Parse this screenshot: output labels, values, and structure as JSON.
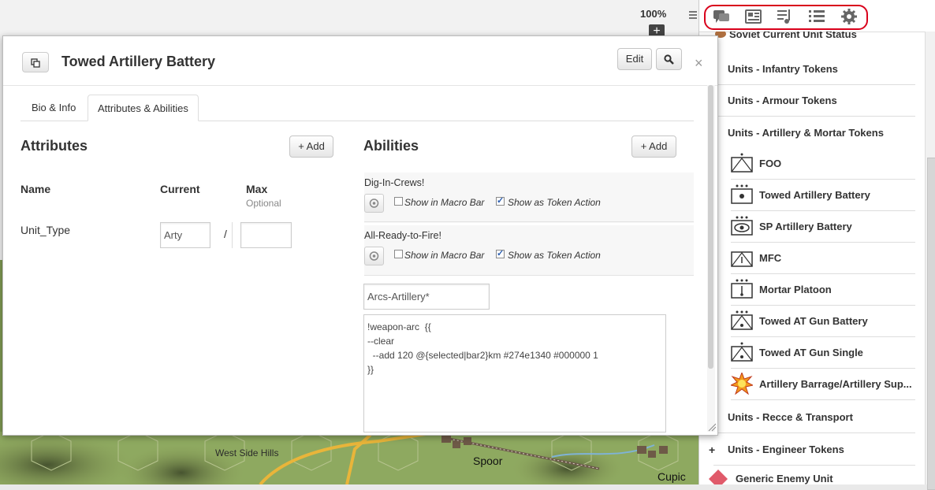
{
  "canvas": {
    "zoom": "100%",
    "zoom_in_label": "+",
    "map_labels": [
      "West Side Hills",
      "Spoor",
      "Cupic"
    ]
  },
  "sidebar": {
    "tabs": [
      {
        "name": "chat",
        "icon": "chat-bubbles-icon"
      },
      {
        "name": "journal",
        "icon": "journal-icon"
      },
      {
        "name": "jukebox",
        "icon": "music-list-icon"
      },
      {
        "name": "compendium",
        "icon": "list-icon"
      },
      {
        "name": "settings",
        "icon": "gear-icon"
      }
    ],
    "highlight_color": "#d9001b",
    "partial_top_label": "Soviet Current Unit Status",
    "folders": [
      {
        "label": "Units - Infantry Tokens",
        "expander": "+"
      },
      {
        "label": "Units - Armour Tokens",
        "expander": "+"
      },
      {
        "label": "Units - Artillery & Mortar Tokens",
        "expander": "-"
      },
      {
        "label": "Units - Recce & Transport",
        "expander": "+"
      },
      {
        "label": "Units - Engineer Tokens",
        "expander": "+"
      }
    ],
    "items": [
      {
        "label": "FOO",
        "icon": "foo-unit-icon"
      },
      {
        "label": "Towed Artillery Battery",
        "icon": "towed-artillery-icon"
      },
      {
        "label": "SP Artillery Battery",
        "icon": "sp-artillery-icon"
      },
      {
        "label": "MFC",
        "icon": "mfc-unit-icon"
      },
      {
        "label": "Mortar Platoon",
        "icon": "mortar-platoon-icon"
      },
      {
        "label": "Towed AT Gun Battery",
        "icon": "towed-at-gun-battery-icon"
      },
      {
        "label": "Towed AT Gun Single",
        "icon": "towed-at-gun-single-icon"
      },
      {
        "label": "Artillery Barrage/Artillery Sup...",
        "icon": "explosion-icon"
      }
    ],
    "bottom_item": {
      "label": "Generic Enemy Unit",
      "icon": "enemy-diamond-icon"
    }
  },
  "dialog": {
    "title": "Towed Artillery Battery",
    "edit_label": "Edit",
    "search_icon": "search-icon",
    "close_label": "×",
    "tabs": [
      {
        "label": "Bio & Info",
        "active": false
      },
      {
        "label": "Attributes & Abilities",
        "active": true
      }
    ],
    "attributes": {
      "heading": "Attributes",
      "add_label": "+ Add",
      "col_name": "Name",
      "col_current": "Current",
      "col_max": "Max",
      "col_max_hint": "Optional",
      "rows": [
        {
          "name": "Unit_Type",
          "current": "Arty",
          "max": "",
          "separator": "/"
        }
      ]
    },
    "abilities": {
      "heading": "Abilities",
      "add_label": "+ Add",
      "macro_bar_label": "Show in Macro Bar",
      "token_action_label": "Show as Token Action",
      "items": [
        {
          "name": "Dig-In-Crews!",
          "show_in_macro_bar": false,
          "show_as_token_action": true
        },
        {
          "name": "All-Ready-to-Fire!",
          "show_in_macro_bar": false,
          "show_as_token_action": true
        }
      ],
      "editing": {
        "name_value": "Arcs-Artillery*",
        "code_lines": [
          "!weapon-arc  {{",
          "--clear",
          "  --add 120 @{selected|bar2}km #274e1340 #000000 1",
          "}}"
        ]
      }
    }
  }
}
